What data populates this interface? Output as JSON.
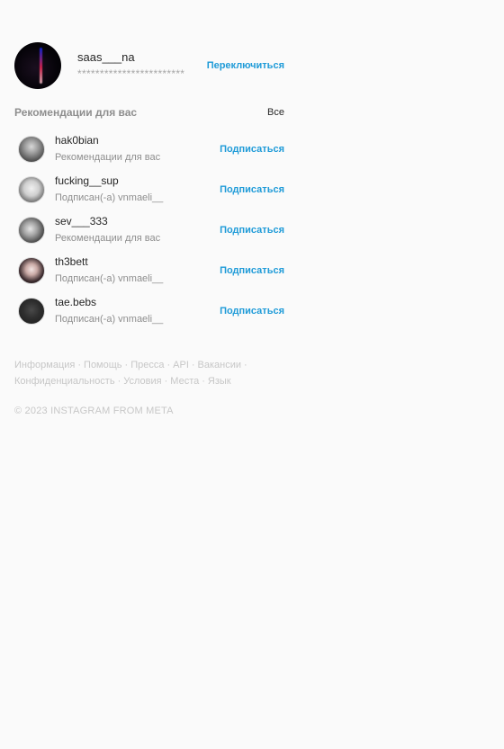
{
  "current_user": {
    "username": "saas___na",
    "subtitle": "************************",
    "switch_label": "Переключиться"
  },
  "recommendations": {
    "title": "Рекомендации для вас",
    "see_all_label": "Все",
    "follow_label": "Подписаться",
    "items": [
      {
        "username": "hak0bian",
        "subtitle": "Рекомендации для вас"
      },
      {
        "username": "fucking__sup",
        "subtitle": "Подписан(-а) vnmaeli__"
      },
      {
        "username": "sev___333",
        "subtitle": "Рекомендации для вас"
      },
      {
        "username": "th3bett",
        "subtitle": "Подписан(-а) vnmaeli__"
      },
      {
        "username": "tae.bebs",
        "subtitle": "Подписан(-а) vnmaeli__"
      }
    ]
  },
  "footer": {
    "links": [
      "Информация",
      "Помощь",
      "Пресса",
      "API",
      "Вакансии",
      "Конфиденциальность",
      "Условия",
      "Места",
      "Язык"
    ],
    "separator": "·",
    "copyright": "© 2023 INSTAGRAM FROM META"
  },
  "colors": {
    "background": "#fafafa",
    "link_blue": "#1f9bd8",
    "text_primary": "#262626",
    "text_secondary": "#8e8e8e",
    "footer_text": "#c7c7c7"
  }
}
